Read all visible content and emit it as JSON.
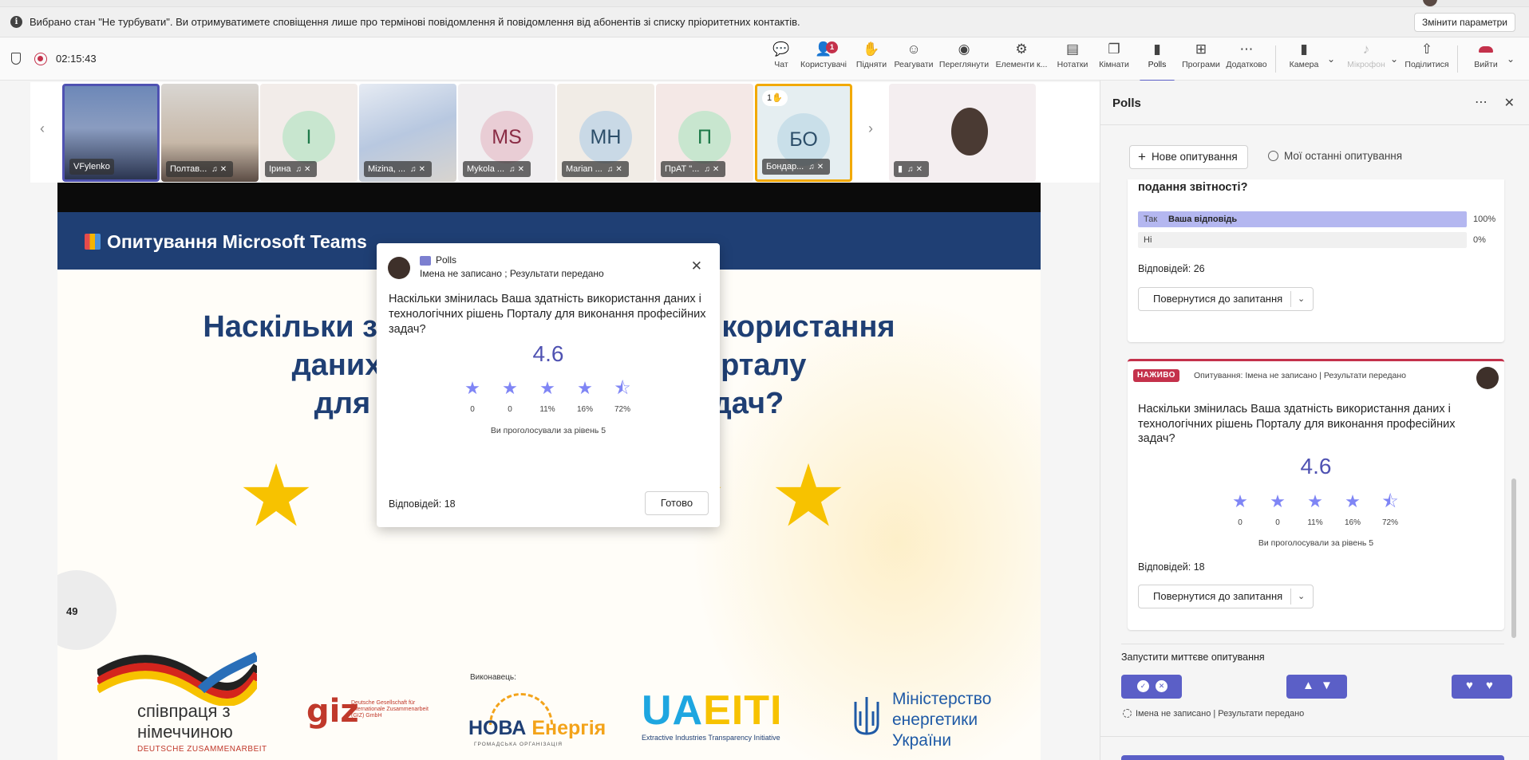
{
  "banner": {
    "message": "Вибрано стан \"Не турбувати\". Ви отримуватимете сповіщення лише про термінові повідомлення й повідомлення від абонентів зі списку пріоритетних контактів.",
    "change_button": "Змінити параметри"
  },
  "toolbar": {
    "timer": "02:15:43",
    "buttons": [
      {
        "label": "Чат",
        "icon": "chat-icon"
      },
      {
        "label": "Користувачі",
        "icon": "people-icon",
        "badge": "1"
      },
      {
        "label": "Підняти",
        "icon": "raise-hand-icon"
      },
      {
        "label": "Реагувати",
        "icon": "react-icon"
      },
      {
        "label": "Переглянути",
        "icon": "view-icon"
      },
      {
        "label": "Елементи к...",
        "icon": "apps-icon"
      },
      {
        "label": "Нотатки",
        "icon": "notes-icon"
      },
      {
        "label": "Кімнати",
        "icon": "rooms-icon"
      },
      {
        "label": "Polls",
        "icon": "polls-icon"
      },
      {
        "label": "Програми",
        "icon": "add-app-icon"
      },
      {
        "label": "Додатково",
        "icon": "more-icon"
      },
      {
        "label": "Камера",
        "icon": "camera-off-icon"
      },
      {
        "label": "Мікрофон",
        "icon": "mic-off-icon"
      },
      {
        "label": "Поділитися",
        "icon": "share-icon"
      },
      {
        "label": "Вийти",
        "icon": "leave-icon"
      }
    ]
  },
  "participants": [
    {
      "name": "VFylenko",
      "type": "video"
    },
    {
      "name": "Полтав...",
      "type": "video"
    },
    {
      "name": "Ірина",
      "initials": "І",
      "color": "#1f7a4a",
      "bg": "#e9f2ec"
    },
    {
      "name": "Mizina, ...",
      "type": "video"
    },
    {
      "name": "Mykola ...",
      "initials": "MS",
      "color": "#8a2c45",
      "bg": "#f3e6ea"
    },
    {
      "name": "Marian ...",
      "initials": "MH",
      "color": "#2d4f6a",
      "bg": "#dfe9ef"
    },
    {
      "name": "ПрАТ \"...",
      "initials": "П",
      "color": "#1f7a4a",
      "bg": "#f7e6e8"
    },
    {
      "name": "Бондар...",
      "initials": "БО",
      "color": "#2d4f6a",
      "bg": "#dcecf2",
      "hand": "1✋"
    },
    {
      "name": "",
      "type": "avatar"
    }
  ],
  "slide": {
    "header": "Опитування Microsoft Teams",
    "question_lines": [
      "Наскільки змін",
      "ь використання",
      "даних і т",
      "ь Порталу",
      "для ви",
      "х задач?"
    ],
    "page_number": "49",
    "coop_line1": "співпраця з",
    "coop_line2": "німеччиною",
    "coop_line3": "DEUTSCHE ZUSAMMENARBEIT",
    "giz_text": "Deutsche Gesellschaft für Internationale Zusammenarbeit (GIZ) GmbH",
    "executor_label": "Виконавець:",
    "nova_a": "НОВА",
    "nova_b": "Енергія",
    "nova_sub": "ГРОМАДСЬКА ОРГАНІЗАЦІЯ",
    "ua_a": "UA",
    "ua_b": "EITI",
    "ua_sub": "Extractive Industries Transparency Initiative",
    "ministry": [
      "Міністерство",
      "енергетики",
      "України"
    ]
  },
  "popup": {
    "title": "Polls",
    "subtitle": "Імена не записано ; Результати передано",
    "question": "Наскільки змінилась Ваша здатність використання даних і технологічних рішень Порталу для виконання професійних задач?",
    "score": "4.6",
    "ratings": [
      "0",
      "0",
      "11%",
      "16%",
      "72%"
    ],
    "voted_text": "Ви проголосували за рівень 5",
    "answers": "Відповідей: 18",
    "done_button": "Готово"
  },
  "panel": {
    "title": "Polls",
    "new_poll": "Нове опитування",
    "recent": "Мої останні опитування",
    "card1": {
      "question_tail": "подання звітності?",
      "options": [
        {
          "label": "Так",
          "yours": "Ваша відповідь",
          "percent": "100%",
          "value": 1.0
        },
        {
          "label": "Ні",
          "yours": "",
          "percent": "0%",
          "value": 0
        }
      ],
      "answers": "Відповідей: 26",
      "return_button": "Повернутися до запитання"
    },
    "card2": {
      "live": "НАЖИВО",
      "meta": "Опитування: Імена не записано | Результати передано",
      "question": "Наскільки змінилась Ваша здатність використання даних і технологічних рішень Порталу для виконання професійних задач?",
      "score": "4.6",
      "ratings": [
        "0",
        "0",
        "11%",
        "16%",
        "72%"
      ],
      "voted_text": "Ви проголосували за рівень 5",
      "answers": "Відповідей: 18",
      "return_button": "Повернутися до запитання"
    },
    "instant_title": "Запустити миттєве опитування",
    "settings_text": "Імена не записано | Результати передано"
  }
}
